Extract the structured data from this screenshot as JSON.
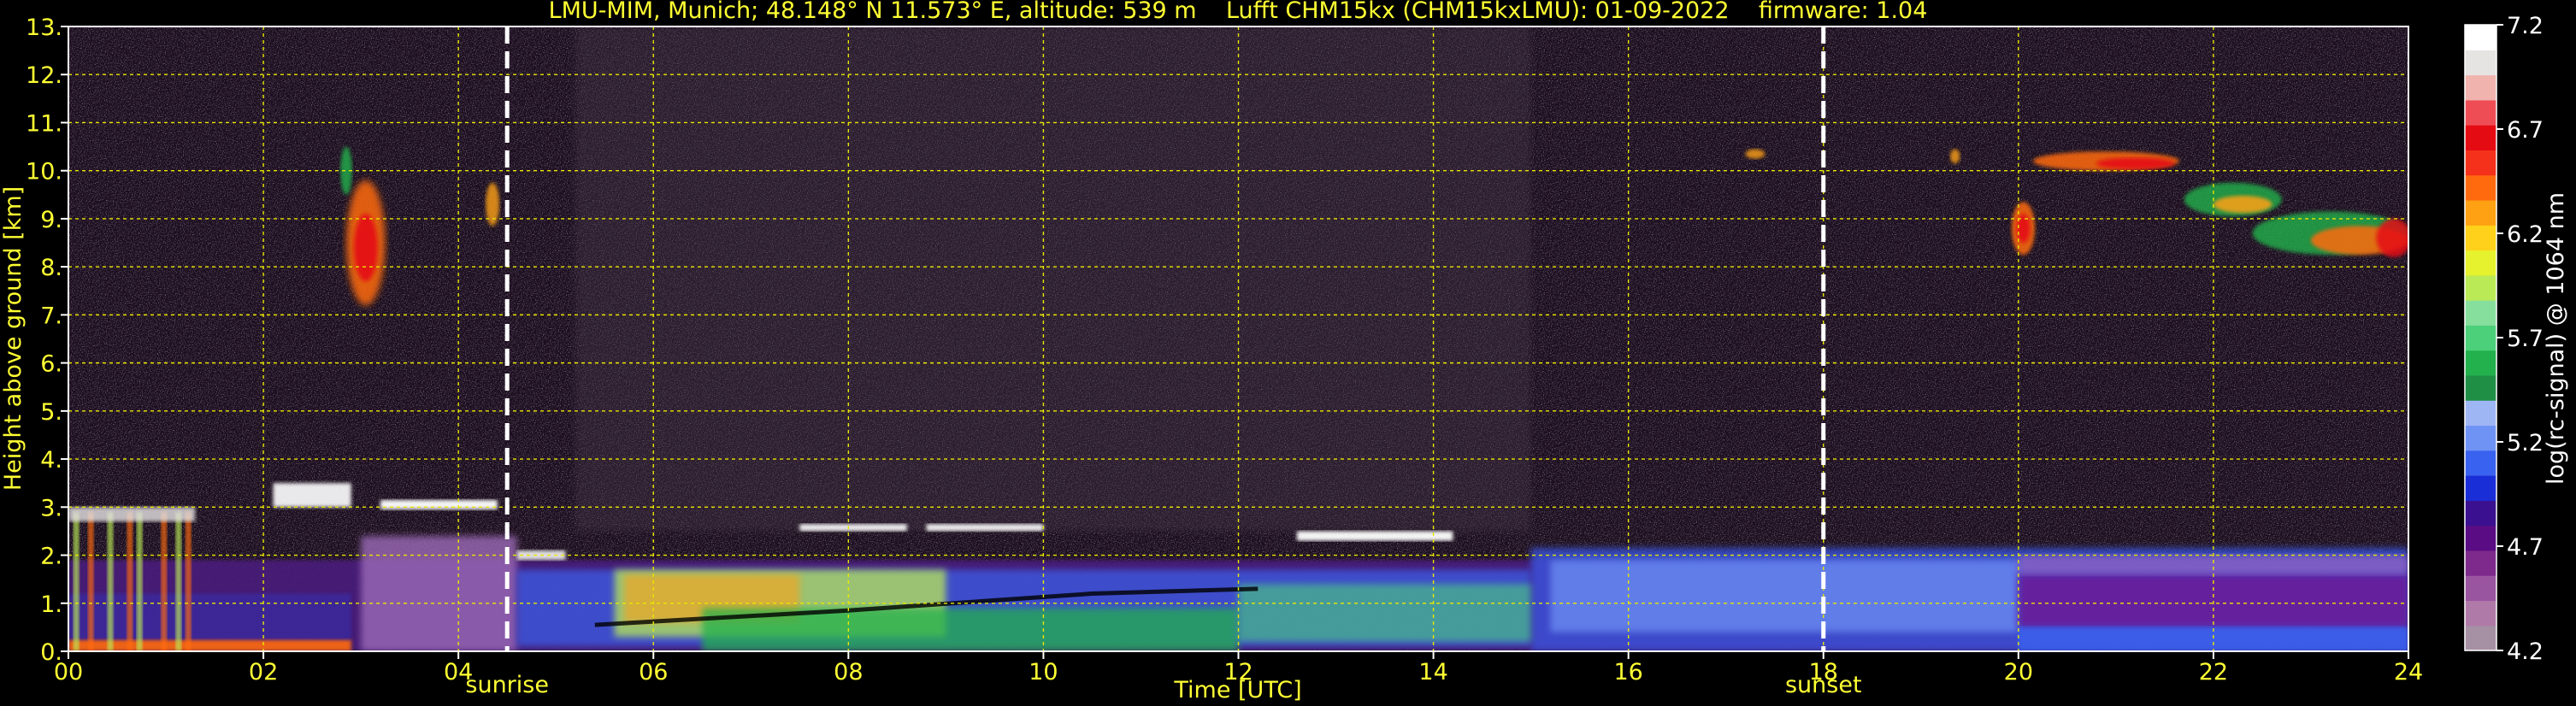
{
  "chart_data": {
    "type": "heatmap",
    "title": "LMU-MIM, Munich; 48.148° N 11.573° E, altitude: 539 m    Lufft CHM15kx (CHM15kxLMU): 01-09-2022    firmware: 1.04",
    "xlabel": "Time [UTC]",
    "ylabel": "Height above ground [km]",
    "colorbar_label": "log(rc-signal) @ 1064 nm",
    "xlim": [
      0,
      24
    ],
    "ylim": [
      0,
      13
    ],
    "x_ticks": [
      0,
      2,
      4,
      6,
      8,
      10,
      12,
      14,
      16,
      18,
      20,
      22,
      24
    ],
    "x_tick_labels": [
      "00",
      "02",
      "04",
      "06",
      "08",
      "10",
      "12",
      "14",
      "16",
      "18",
      "20",
      "22",
      "24"
    ],
    "y_ticks": [
      0,
      1,
      2,
      3,
      4,
      5,
      6,
      7,
      8,
      9,
      10,
      11,
      12,
      13
    ],
    "y_tick_labels": [
      "0.",
      "1.",
      "2.",
      "3.",
      "4.",
      "5.",
      "6.",
      "7.",
      "8.",
      "9.",
      "10.",
      "11.",
      "12.",
      "13."
    ],
    "grid": true,
    "colorbar_range": [
      4.2,
      7.2
    ],
    "colorbar_ticks": [
      4.2,
      4.7,
      5.2,
      5.7,
      6.2,
      6.7,
      7.2
    ],
    "colorbar_tick_labels": [
      "4.2",
      "4.7",
      "5.2",
      "5.7",
      "6.2",
      "6.7",
      "7.2"
    ],
    "colorbar_colors": [
      "#a690a4",
      "#b07aa8",
      "#9a55a0",
      "#7d2a8c",
      "#5a0c84",
      "#3a1090",
      "#1a2ed8",
      "#3a62f0",
      "#6f93f5",
      "#9fb6f5",
      "#1f8f46",
      "#22b14c",
      "#4cd07a",
      "#86df9c",
      "#baea55",
      "#e5f22d",
      "#ffd11a",
      "#ffa112",
      "#ff6a0f",
      "#f5311b",
      "#e50b12",
      "#ee4d55",
      "#f0b3ad",
      "#e6e3e3",
      "#ffffff"
    ],
    "markers": [
      {
        "label": "sunrise",
        "x": 4.5
      },
      {
        "label": "sunset",
        "x": 18.0
      }
    ],
    "features": [
      {
        "kind": "cirrus",
        "x": [
          2.8,
          3.3
        ],
        "height": [
          7.3,
          10.6
        ]
      },
      {
        "kind": "cirrus",
        "x": [
          4.25,
          4.45
        ],
        "height": [
          8.8,
          9.8
        ]
      },
      {
        "kind": "cirrus",
        "x": [
          19.9,
          24.0
        ],
        "height": [
          7.8,
          10.4
        ]
      },
      {
        "kind": "low-cloud",
        "x": [
          1.9,
          4.4
        ],
        "height": [
          2.8,
          3.6
        ]
      },
      {
        "kind": "low-cloud",
        "x": [
          7.5,
          10.0
        ],
        "height": [
          2.45,
          2.65
        ]
      },
      {
        "kind": "low-cloud",
        "x": [
          12.6,
          14.2
        ],
        "height": [
          2.3,
          2.5
        ]
      },
      {
        "kind": "boundary-layer",
        "x": [
          0,
          24
        ],
        "height": [
          0,
          2.1
        ]
      }
    ]
  }
}
